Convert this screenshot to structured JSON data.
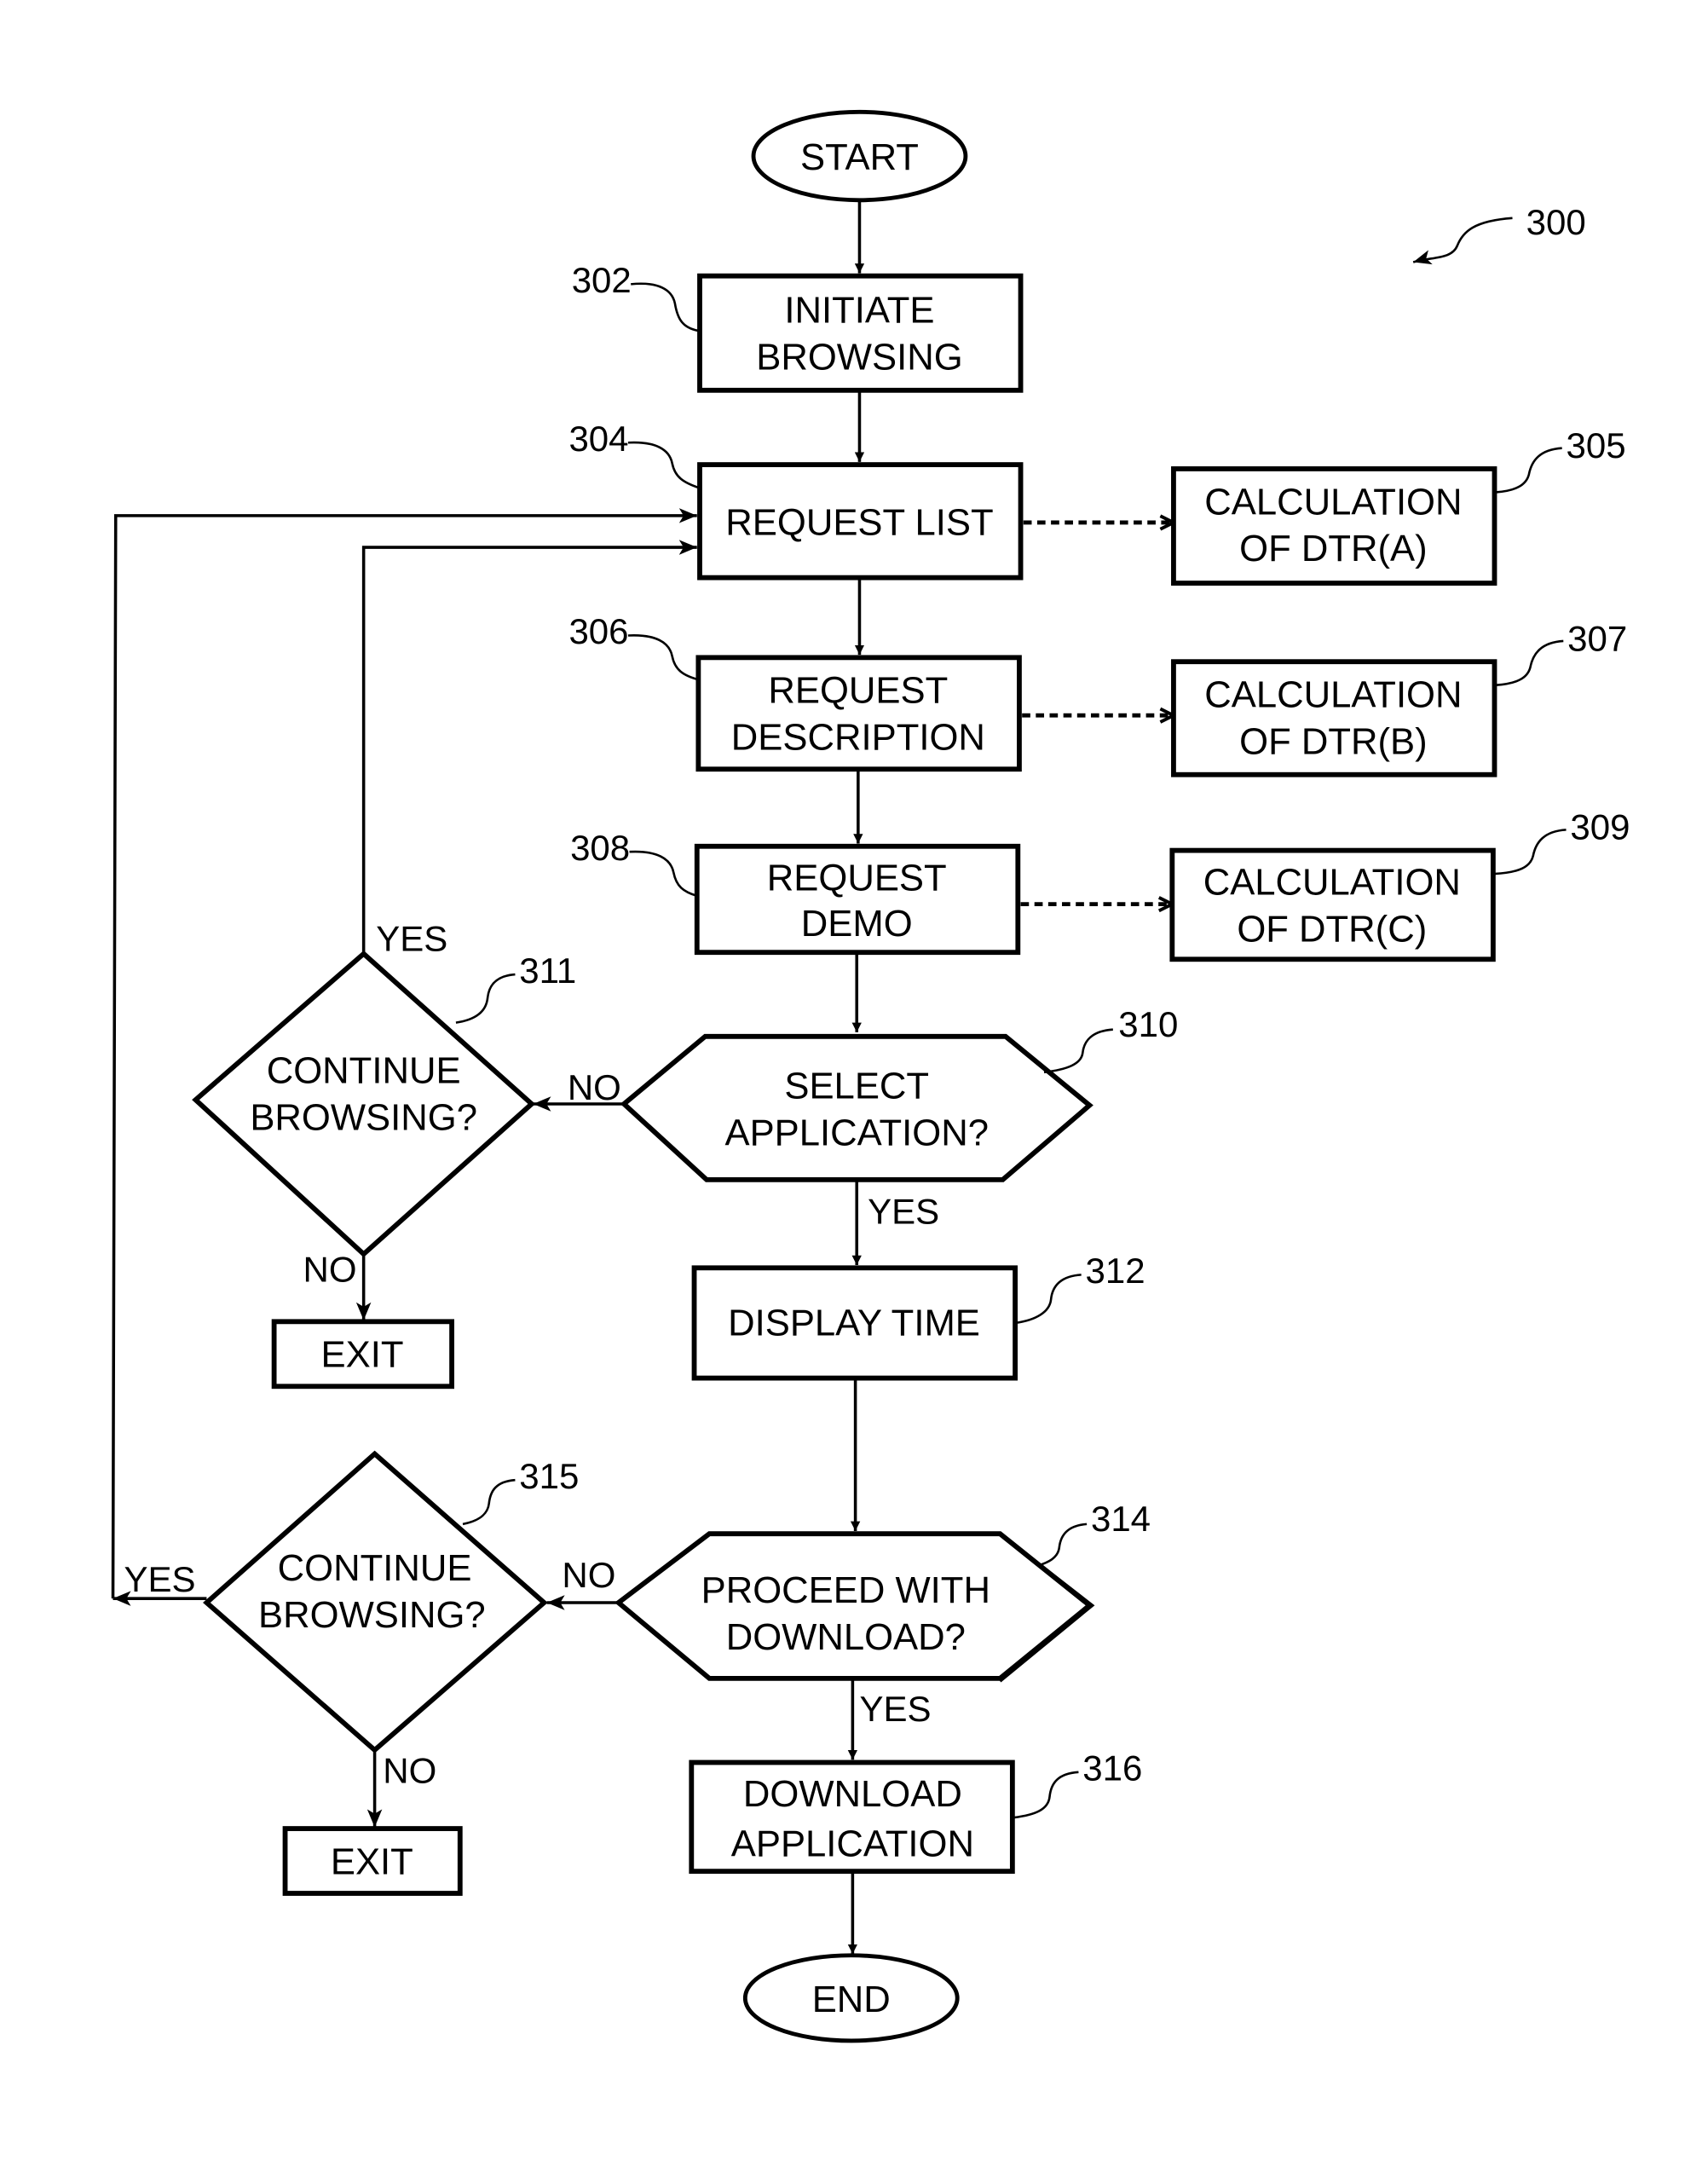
{
  "figure": {
    "reference": "300",
    "start": "START",
    "end": "END",
    "steps": {
      "s302": {
        "ref": "302",
        "lines": [
          "INITIATE",
          "BROWSING"
        ]
      },
      "s304": {
        "ref": "304",
        "lines": [
          "REQUEST LIST"
        ]
      },
      "s305": {
        "ref": "305",
        "lines": [
          "CALCULATION",
          "OF DTR(A)"
        ]
      },
      "s306": {
        "ref": "306",
        "lines": [
          "REQUEST",
          "DESCRIPTION"
        ]
      },
      "s307": {
        "ref": "307",
        "lines": [
          "CALCULATION",
          "OF DTR(B)"
        ]
      },
      "s308": {
        "ref": "308",
        "lines": [
          "REQUEST",
          "DEMO"
        ]
      },
      "s309": {
        "ref": "309",
        "lines": [
          "CALCULATION",
          "OF DTR(C)"
        ]
      },
      "s310": {
        "ref": "310",
        "lines": [
          "SELECT",
          "APPLICATION?"
        ]
      },
      "s311": {
        "ref": "311",
        "lines": [
          "CONTINUE",
          "BROWSING?"
        ]
      },
      "s312": {
        "ref": "312",
        "lines": [
          "DISPLAY TIME"
        ]
      },
      "s314": {
        "ref": "314",
        "lines": [
          "PROCEED WITH",
          "DOWNLOAD?"
        ]
      },
      "s315": {
        "ref": "315",
        "lines": [
          "CONTINUE",
          "BROWSING?"
        ]
      },
      "s316": {
        "ref": "316",
        "lines": [
          "DOWNLOAD",
          "APPLICATION"
        ]
      },
      "exit1": {
        "lines": [
          "EXIT"
        ]
      },
      "exit2": {
        "lines": [
          "EXIT"
        ]
      }
    },
    "edge_labels": {
      "yes": "YES",
      "no": "NO"
    }
  }
}
